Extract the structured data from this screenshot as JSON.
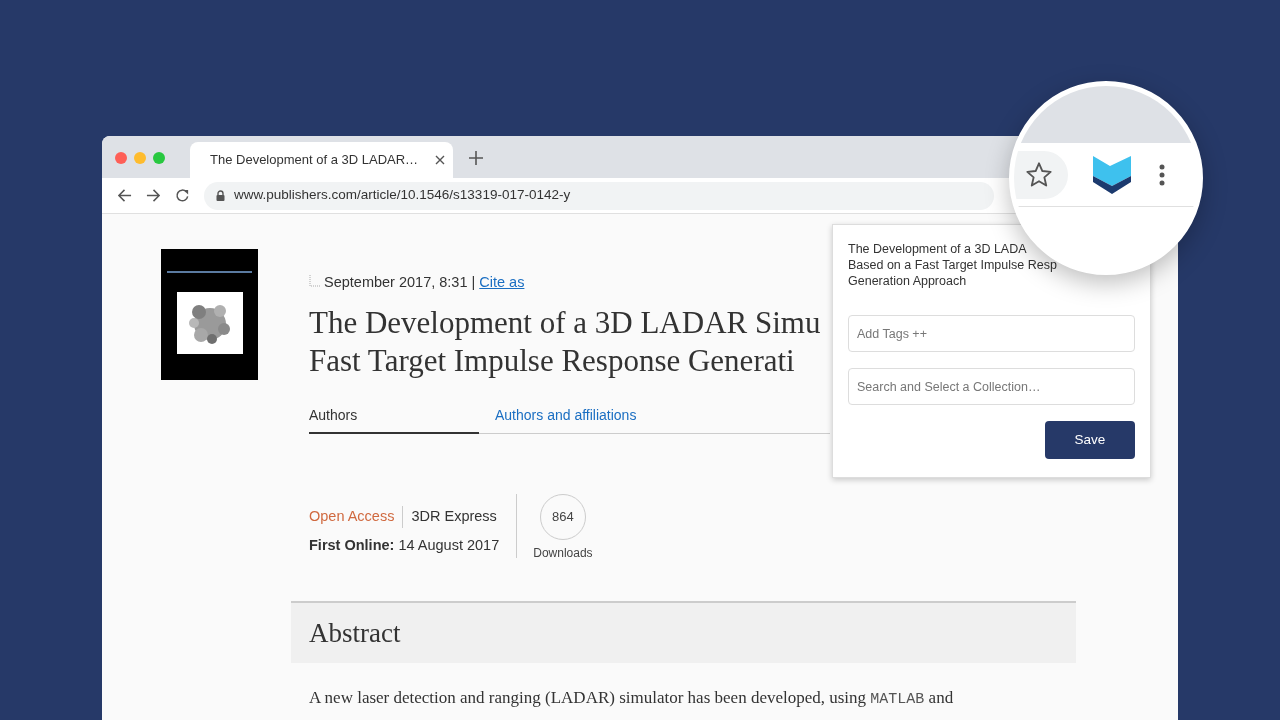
{
  "browser": {
    "tab": {
      "title": "The Development of a 3D LADAR…"
    },
    "url": "www.publishers.com/article/10.1546/s13319-017-0142-y"
  },
  "article": {
    "date": "September 2017, 8:31",
    "separator": "|",
    "cite_link": "Cite as",
    "title_lines": [
      "The Development of a 3D LADAR Simu",
      "Fast Target Impulse Response Generati"
    ],
    "tabs": [
      {
        "label": "Authors",
        "selected": true
      },
      {
        "label": "Authors and affiliations",
        "selected": false
      }
    ],
    "access": "Open Access",
    "journal": "3DR Express",
    "first_online": "**First Online:** 14 August 2017",
    "downloads": {
      "count": "864",
      "label": "Downloads"
    },
    "abstract": {
      "heading": "Abstract",
      "segments": [
        {
          "kind": "text",
          "text": "A new laser detection and ranging (LADAR) simulator has been developed, using "
        },
        {
          "kind": "code",
          "text": "MATLAB"
        },
        {
          "kind": "text",
          "text": " and"
        }
      ]
    }
  },
  "popup": {
    "title_lines": [
      "The Development of a 3D LADA",
      "Based on a Fast Target Impulse Resp",
      "Generation Approach"
    ],
    "tags_field": {
      "placeholder": "Add Tags ++"
    },
    "collection_field": {
      "placeholder": "Search and Select a Collection…"
    },
    "save_button": "Save"
  }
}
